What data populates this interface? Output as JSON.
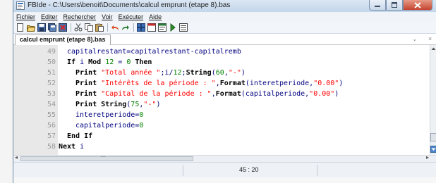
{
  "window": {
    "title": "FBIde - C:\\Users\\benoit\\Documents\\calcul emprunt (etape 8).bas",
    "app_icon": "fbide-icon"
  },
  "window_controls": [
    "minimize-icon",
    "maximize-icon",
    "close-icon"
  ],
  "menu": [
    "Fichier",
    "Editer",
    "Rechercher",
    "Voir",
    "Exécuter",
    "Aide"
  ],
  "toolbar": [
    "new-file-icon",
    "open-icon",
    "save-icon",
    "save-all-icon",
    "close-file-icon",
    "cut-icon",
    "copy-icon",
    "paste-icon",
    "undo-icon",
    "redo-icon",
    "compile-icon",
    "run-icon",
    "compile-run-icon",
    "run-arrow-icon",
    "output-icon"
  ],
  "tab": {
    "label": "calcul emprunt (etape 8).bas"
  },
  "tab_controls": {
    "dropdown": "⌄",
    "close": "×"
  },
  "colors": {
    "keyword": "#000000",
    "string": "#ff0000",
    "number": "#008000",
    "identifier": "#000080",
    "line_number": "#9a9a9a"
  },
  "code_lines": [
    {
      "number": "49",
      "indent": 2,
      "tokens": [
        {
          "t": "capitalrestant=capitalrestant-capitalremb",
          "c": "identifier"
        }
      ]
    },
    {
      "number": "50",
      "indent": 2,
      "tokens": [
        {
          "t": "If",
          "c": "keyword"
        },
        {
          "t": " i ",
          "c": "identifier"
        },
        {
          "t": "Mod",
          "c": "keyword"
        },
        {
          "t": " ",
          "c": "identifier"
        },
        {
          "t": "12",
          "c": "number"
        },
        {
          "t": " = ",
          "c": "identifier"
        },
        {
          "t": "0",
          "c": "number"
        },
        {
          "t": " ",
          "c": "identifier"
        },
        {
          "t": "Then",
          "c": "keyword"
        }
      ]
    },
    {
      "number": "51",
      "indent": 4,
      "tokens": [
        {
          "t": "Print",
          "c": "keyword"
        },
        {
          "t": " ",
          "c": "identifier"
        },
        {
          "t": "\"Total année \"",
          "c": "string"
        },
        {
          "t": ";i/",
          "c": "identifier"
        },
        {
          "t": "12",
          "c": "number"
        },
        {
          "t": ";",
          "c": "identifier"
        },
        {
          "t": "String",
          "c": "keyword"
        },
        {
          "t": "(",
          "c": "identifier"
        },
        {
          "t": "60",
          "c": "number"
        },
        {
          "t": ",",
          "c": "identifier"
        },
        {
          "t": "\"-\"",
          "c": "string"
        },
        {
          "t": ")",
          "c": "identifier"
        }
      ]
    },
    {
      "number": "52",
      "indent": 4,
      "tokens": [
        {
          "t": "Print",
          "c": "keyword"
        },
        {
          "t": " ",
          "c": "identifier"
        },
        {
          "t": "\"Intérêts de la période : \"",
          "c": "string"
        },
        {
          "t": ",",
          "c": "identifier"
        },
        {
          "t": "Format",
          "c": "keyword"
        },
        {
          "t": "(interetperiode,",
          "c": "identifier"
        },
        {
          "t": "\"0.00\"",
          "c": "string"
        },
        {
          "t": ")",
          "c": "identifier"
        }
      ]
    },
    {
      "number": "53",
      "indent": 4,
      "tokens": [
        {
          "t": "Print",
          "c": "keyword"
        },
        {
          "t": " ",
          "c": "identifier"
        },
        {
          "t": "\"Capital de la période : \"",
          "c": "string"
        },
        {
          "t": ",",
          "c": "identifier"
        },
        {
          "t": "Format",
          "c": "keyword"
        },
        {
          "t": "(capitalperiode,",
          "c": "identifier"
        },
        {
          "t": "\"0.00\"",
          "c": "string"
        },
        {
          "t": ")",
          "c": "identifier"
        }
      ]
    },
    {
      "number": "54",
      "indent": 4,
      "tokens": [
        {
          "t": "Print",
          "c": "keyword"
        },
        {
          "t": " ",
          "c": "identifier"
        },
        {
          "t": "String",
          "c": "keyword"
        },
        {
          "t": "(",
          "c": "identifier"
        },
        {
          "t": "75",
          "c": "number"
        },
        {
          "t": ",",
          "c": "identifier"
        },
        {
          "t": "\"-\"",
          "c": "string"
        },
        {
          "t": ")",
          "c": "identifier"
        }
      ]
    },
    {
      "number": "55",
      "indent": 4,
      "tokens": [
        {
          "t": "interetperiode=",
          "c": "identifier"
        },
        {
          "t": "0",
          "c": "number"
        }
      ]
    },
    {
      "number": "56",
      "indent": 4,
      "tokens": [
        {
          "t": "capitalperiode=",
          "c": "identifier"
        },
        {
          "t": "0",
          "c": "number"
        }
      ]
    },
    {
      "number": "57",
      "indent": 2,
      "tokens": [
        {
          "t": "End If",
          "c": "keyword"
        }
      ]
    },
    {
      "number": "58",
      "indent": 0,
      "tokens": [
        {
          "t": "Next",
          "c": "keyword"
        },
        {
          "t": " i",
          "c": "identifier"
        }
      ]
    }
  ],
  "horizontal_scrollbar": {
    "left_arrow": "◂",
    "grip": "⋯",
    "right_arrow": "▸"
  },
  "status": {
    "cursor_position": "45 : 20"
  }
}
